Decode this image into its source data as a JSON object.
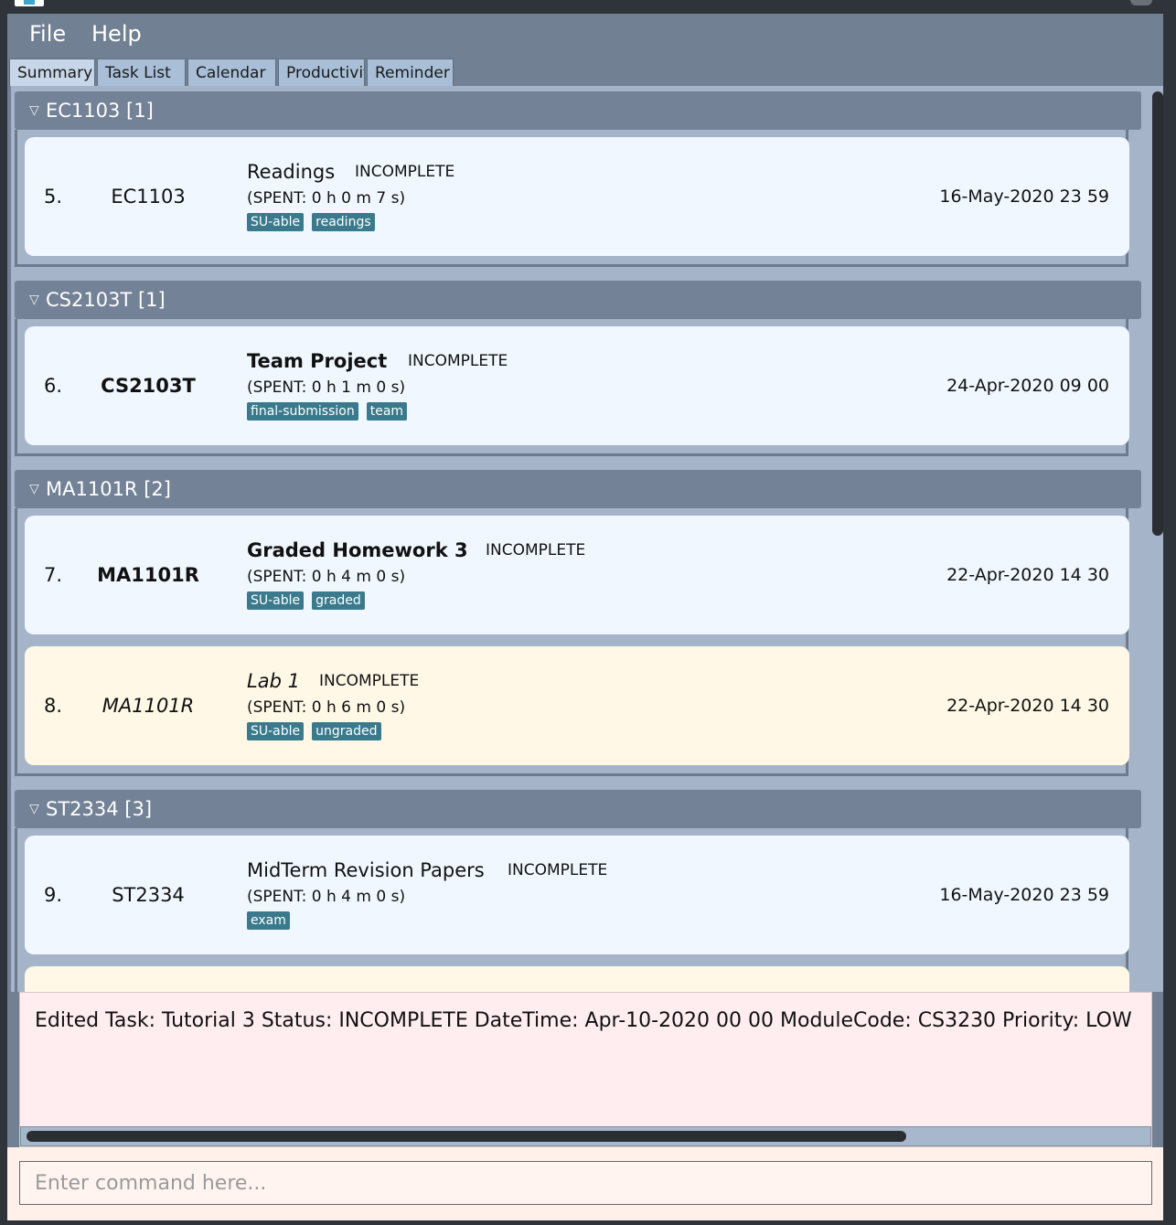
{
  "menu": {
    "file": "File",
    "help": "Help"
  },
  "tabs": [
    {
      "label": "Summary"
    },
    {
      "label": "Task List"
    },
    {
      "label": "Calendar"
    },
    {
      "label": "Productivity"
    },
    {
      "label": "Reminder"
    }
  ],
  "groups": [
    {
      "header": "EC1103 [1]",
      "tasks": [
        {
          "index": "5.",
          "module": "EC1103",
          "name": "Readings",
          "status": "INCOMPLETE",
          "spent": "(SPENT: 0 h 0 m 7 s)",
          "tags": [
            "SU-able",
            "readings"
          ],
          "date": "16-May-2020 23 59"
        }
      ]
    },
    {
      "header": "CS2103T [1]",
      "tasks": [
        {
          "index": "6.",
          "module": "CS2103T",
          "name": "Team Project",
          "status": "INCOMPLETE",
          "spent": "(SPENT: 0 h 1 m 0 s)",
          "tags": [
            "final-submission",
            "team"
          ],
          "date": "24-Apr-2020 09 00"
        }
      ]
    },
    {
      "header": "MA1101R [2]",
      "tasks": [
        {
          "index": "7.",
          "module": "MA1101R",
          "name": "Graded Homework 3",
          "status": "INCOMPLETE",
          "spent": "(SPENT: 0 h 4 m 0 s)",
          "tags": [
            "SU-able",
            "graded"
          ],
          "date": "22-Apr-2020 14 30"
        },
        {
          "index": "8.",
          "module": "MA1101R",
          "name": "Lab 1",
          "status": "INCOMPLETE",
          "spent": "(SPENT: 0 h 6 m 0 s)",
          "tags": [
            "SU-able",
            "ungraded"
          ],
          "date": "22-Apr-2020 14 30"
        }
      ]
    },
    {
      "header": "ST2334 [3]",
      "tasks": [
        {
          "index": "9.",
          "module": "ST2334",
          "name": "MidTerm Revision Papers",
          "status": "INCOMPLETE",
          "spent": "(SPENT: 0 h 4 m 0 s)",
          "tags": [
            "exam"
          ],
          "date": "16-May-2020 23 59"
        }
      ]
    }
  ],
  "result": {
    "text": "Edited Task: Tutorial 3 Status: INCOMPLETE DateTime: Apr-10-2020 00 00 ModuleCode: CS3230 Priority: LOW"
  },
  "command": {
    "placeholder": "Enter command here..."
  },
  "colors": {
    "window_bg": "#718093",
    "card_bg": "#f0f7ff",
    "card_alt_bg": "#fff8e6",
    "tag_bg": "#3a7a8c",
    "result_bg": "#ffedef"
  }
}
